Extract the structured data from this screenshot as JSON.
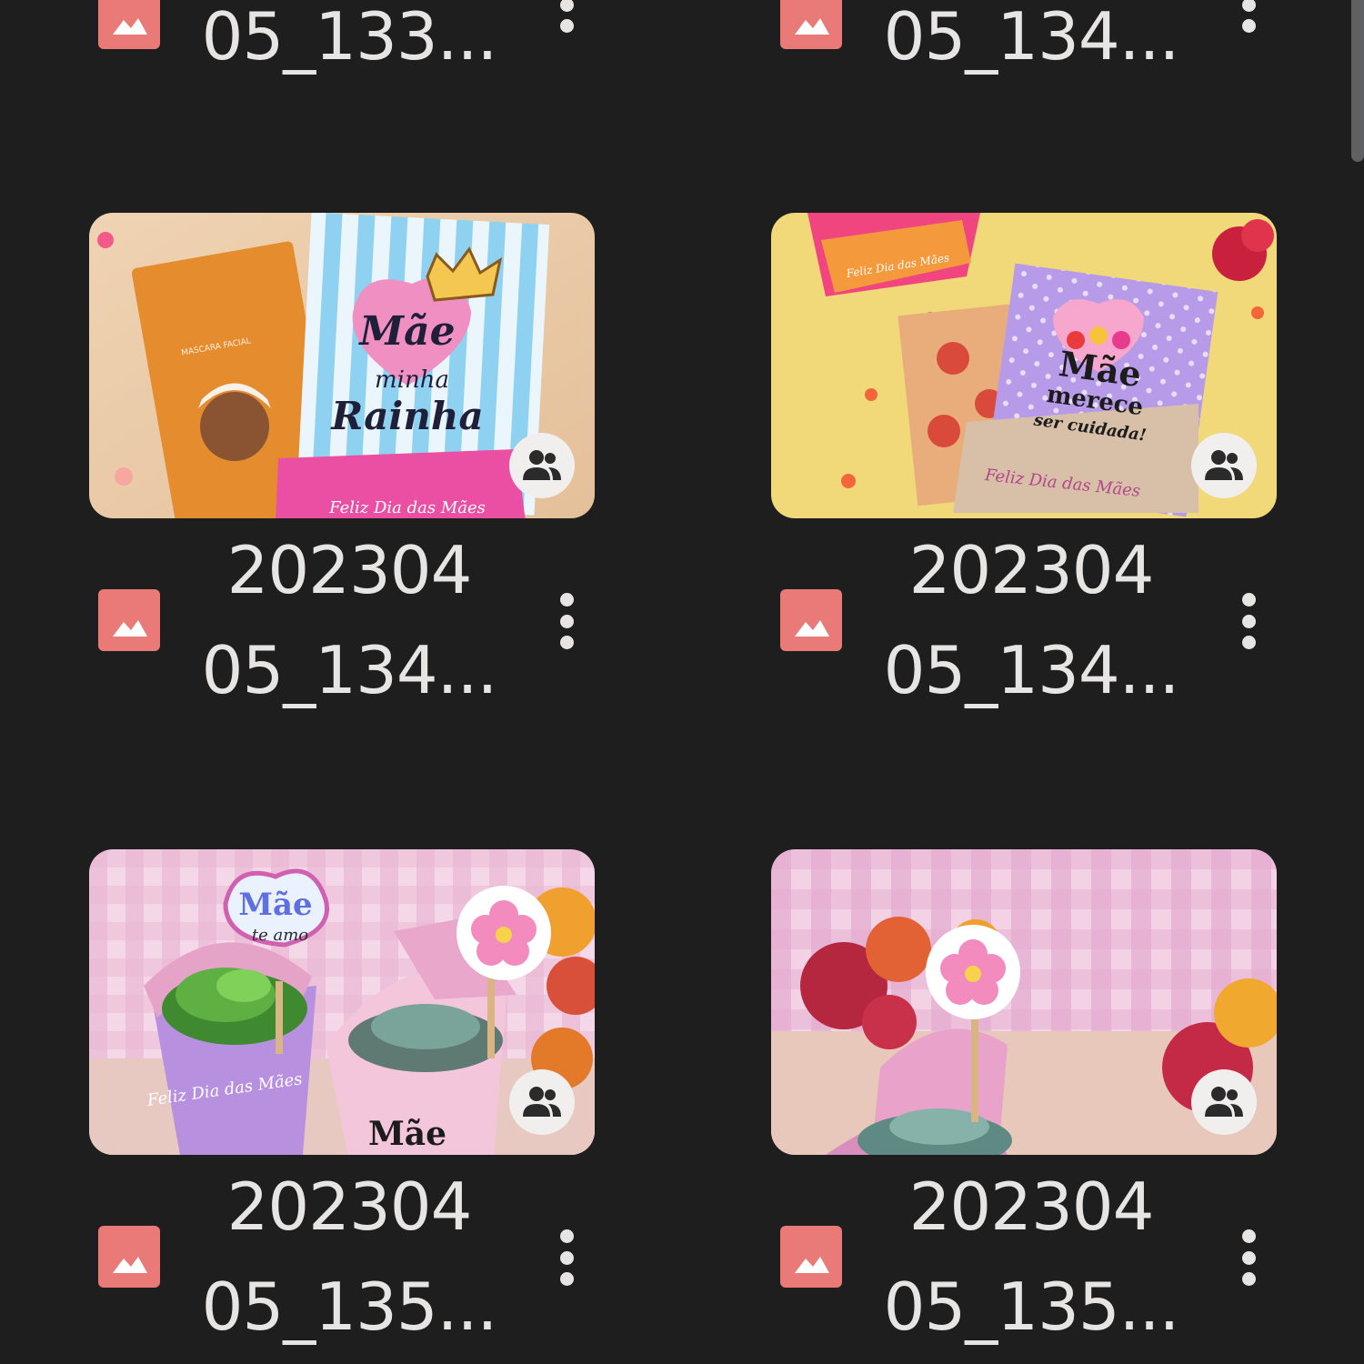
{
  "accent_colors": {
    "background": "#1e1e1f",
    "text": "#e6e5e3",
    "image_type_icon": "#ea7a78",
    "shared_badge": "#f1efee"
  },
  "top_row": [
    {
      "name_line2": "05_133...",
      "type_icon": "image-icon",
      "menu_icon": "more-vert-icon"
    },
    {
      "name_line2": "05_134...",
      "type_icon": "image-icon",
      "menu_icon": "more-vert-icon"
    }
  ],
  "files": [
    {
      "name_line1": "202304",
      "name_line2": "05_134...",
      "thumbnail_texts": [
        "Mãe",
        "minha",
        "Rainha",
        "Feliz Dia das Mães",
        "MASCARA FACIAL"
      ],
      "shared": true,
      "shared_icon": "people-icon",
      "type_icon": "image-icon",
      "menu_icon": "more-vert-icon"
    },
    {
      "name_line1": "202304",
      "name_line2": "05_134...",
      "thumbnail_texts": [
        "Mãe",
        "merece",
        "ser cuidada!",
        "Feliz Dia das Mães"
      ],
      "shared": true,
      "shared_icon": "people-icon",
      "type_icon": "image-icon",
      "menu_icon": "more-vert-icon"
    },
    {
      "name_line1": "202304",
      "name_line2": "05_135...",
      "thumbnail_texts": [
        "Mãe",
        "te amo",
        "Feliz Dia das Mães",
        "Mãe"
      ],
      "shared": true,
      "shared_icon": "people-icon",
      "type_icon": "image-icon",
      "menu_icon": "more-vert-icon"
    },
    {
      "name_line1": "202304",
      "name_line2": "05_135...",
      "thumbnail_texts": [],
      "shared": true,
      "shared_icon": "people-icon",
      "type_icon": "image-icon",
      "menu_icon": "more-vert-icon"
    }
  ]
}
